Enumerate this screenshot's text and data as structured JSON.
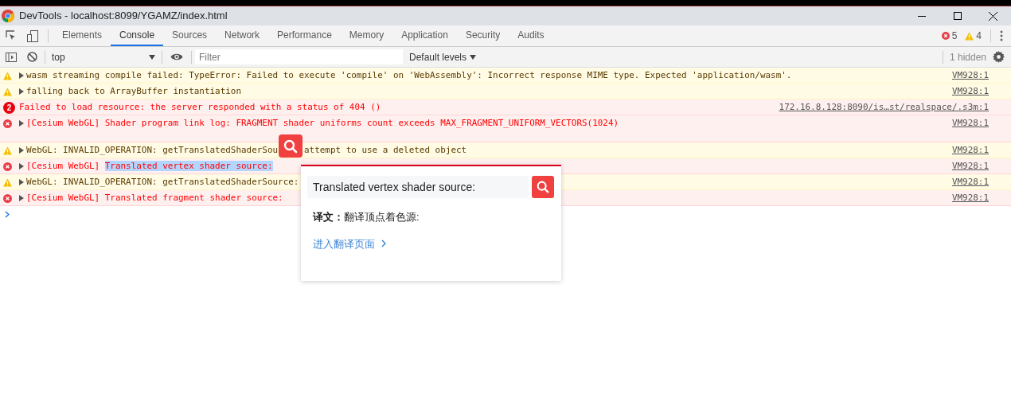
{
  "window": {
    "title": "DevTools - localhost:8099/YGAMZ/index.html"
  },
  "tabs": [
    {
      "label": "Elements",
      "selected": false
    },
    {
      "label": "Console",
      "selected": true
    },
    {
      "label": "Sources",
      "selected": false
    },
    {
      "label": "Network",
      "selected": false
    },
    {
      "label": "Performance",
      "selected": false
    },
    {
      "label": "Memory",
      "selected": false
    },
    {
      "label": "Application",
      "selected": false
    },
    {
      "label": "Security",
      "selected": false
    },
    {
      "label": "Audits",
      "selected": false
    }
  ],
  "counts": {
    "errors": "5",
    "warnings": "4"
  },
  "toolbar": {
    "context": "top",
    "filter_placeholder": "Filter",
    "levels": "Default levels",
    "hidden": "1 hidden"
  },
  "messages": [
    {
      "kind": "warning",
      "expandable": true,
      "text": "wasm streaming compile failed: TypeError: Failed to execute 'compile' on 'WebAssembly': Incorrect response MIME type. Expected 'application/wasm'.",
      "source": "VM928:1"
    },
    {
      "kind": "warning",
      "expandable": true,
      "text": "falling back to ArrayBuffer instantiation",
      "source": "VM928:1"
    },
    {
      "kind": "error",
      "expandable": false,
      "repeat": "2",
      "text": "Failed to load resource: the server responded with a status of 404 ()",
      "source": "172.16.8.128:8090/is…st/realspace/.s3m:1"
    },
    {
      "kind": "error",
      "expandable": true,
      "tall": true,
      "text": "[Cesium WebGL] Shader program link log: FRAGMENT shader uniforms count exceeds MAX_FRAGMENT_UNIFORM_VECTORS(1024)",
      "source": "VM928:1"
    },
    {
      "kind": "warning",
      "expandable": true,
      "text": "WebGL: INVALID_OPERATION: getTranslatedShaderSou",
      "after_cover": "attempt to use a deleted object",
      "source": "VM928:1"
    },
    {
      "kind": "error",
      "expandable": true,
      "text": "[Cesium WebGL] ",
      "highlight": "Translated vertex shader source:",
      "source": "VM928:1"
    },
    {
      "kind": "warning",
      "expandable": true,
      "text": "WebGL: INVALID_OPERATION: getTranslatedShaderSource:",
      "source": "VM928:1"
    },
    {
      "kind": "error",
      "expandable": true,
      "text": "[Cesium WebGL] Translated fragment shader source:",
      "source": "VM928:1"
    }
  ],
  "translator": {
    "query": "Translated vertex shader source:",
    "result_label": "译文：",
    "result": "翻译顶点着色源:",
    "link": "进入翻译页面"
  }
}
